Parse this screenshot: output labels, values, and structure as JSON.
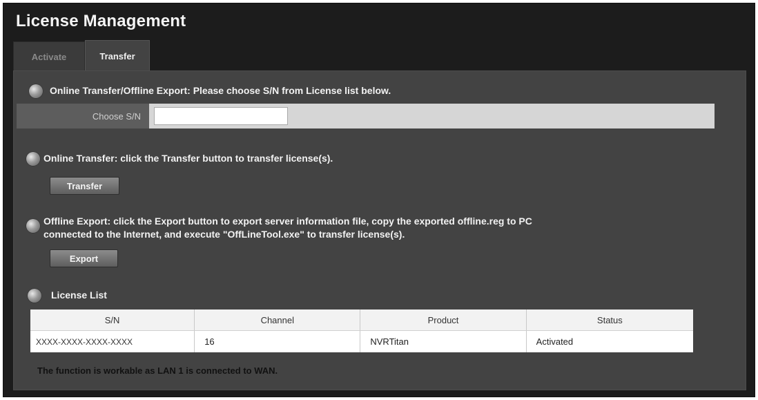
{
  "header": {
    "title": "License Management"
  },
  "tabs": [
    {
      "label": "Activate",
      "active": false
    },
    {
      "label": "Transfer",
      "active": true
    }
  ],
  "sections": {
    "choose": {
      "text": "Online Transfer/Offline Export: Please choose S/N from License list below.",
      "field_label": "Choose S/N",
      "field_value": ""
    },
    "online": {
      "text": "Online Transfer: click the Transfer button to transfer license(s).",
      "button_label": "Transfer"
    },
    "offline": {
      "text_line1": "Offline Export: click the Export button to export server information file, copy the exported offline.reg to PC",
      "text_line2": "connected to the Internet, and execute \"OffLineTool.exe\" to transfer license(s).",
      "button_label": "Export"
    },
    "list": {
      "title": "License List",
      "columns": [
        "S/N",
        "Channel",
        "Product",
        "Status"
      ],
      "rows": [
        [
          "XXXX-XXXX-XXXX-XXXX",
          "16",
          "NVRTitan",
          "Activated"
        ]
      ]
    }
  },
  "footnote": "The function is workable as LAN 1 is connected to WAN.",
  "colors": {
    "frame_bg": "#1c1c1c",
    "panel_bg": "#434343",
    "row_bg": "#d6d6d6",
    "table_header_bg": "#f2f2f2"
  },
  "icons": {
    "section_bullet": "round-bullet-icon"
  }
}
